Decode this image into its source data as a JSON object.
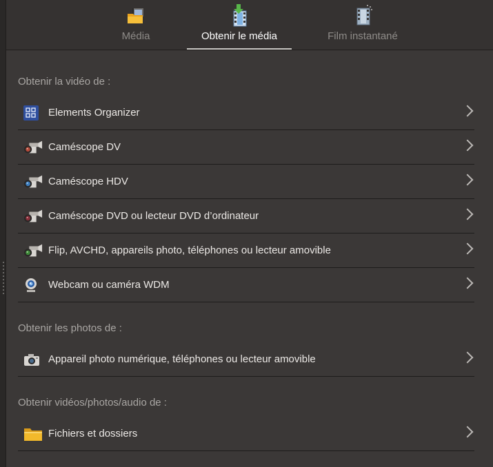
{
  "tabs": [
    {
      "label": "Média",
      "icon": "media-folder-icon",
      "active": false
    },
    {
      "label": "Obtenir le média",
      "icon": "get-media-icon",
      "active": true
    },
    {
      "label": "Film instantané",
      "icon": "instant-movie-icon",
      "active": false
    }
  ],
  "sections": [
    {
      "title": "Obtenir la vidéo de :",
      "items": [
        {
          "label": "Elements Organizer",
          "icon": "organizer-icon"
        },
        {
          "label": "Caméscope DV",
          "icon": "camcorder-icon"
        },
        {
          "label": "Caméscope HDV",
          "icon": "camcorder-icon"
        },
        {
          "label": "Caméscope DVD ou lecteur DVD d’ordinateur",
          "icon": "camcorder-icon"
        },
        {
          "label": "Flip, AVCHD, appareils photo, téléphones ou lecteur amovible",
          "icon": "camcorder-icon"
        },
        {
          "label": "Webcam ou caméra WDM",
          "icon": "webcam-icon"
        }
      ]
    },
    {
      "title": "Obtenir les photos de :",
      "items": [
        {
          "label": "Appareil photo numérique, téléphones ou lecteur amovible",
          "icon": "camera-icon"
        }
      ]
    },
    {
      "title": "Obtenir vidéos/photos/audio de :",
      "items": [
        {
          "label": "Fichiers et dossiers",
          "icon": "folder-icon"
        }
      ]
    }
  ],
  "colors": {
    "background": "#3b3837",
    "tabbar": "#353231",
    "organizer_blue": "#2f4f9e",
    "folder_yellow": "#f2b92b"
  }
}
